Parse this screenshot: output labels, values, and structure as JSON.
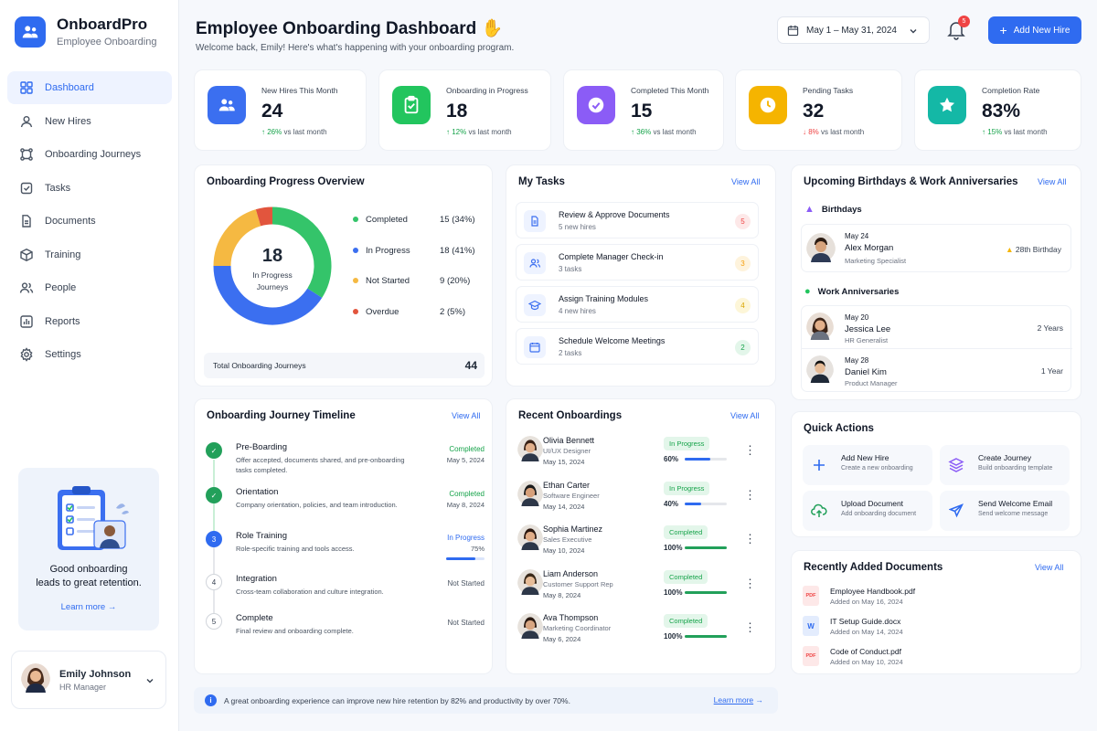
{
  "app": {
    "name": "OnboardPro",
    "subtitle": "Employee Onboarding"
  },
  "sidebar": {
    "items": [
      {
        "label": "Dashboard",
        "icon": "grid-icon",
        "active": true
      },
      {
        "label": "New Hires",
        "icon": "user-icon"
      },
      {
        "label": "Onboarding Journeys",
        "icon": "journey-icon"
      },
      {
        "label": "Tasks",
        "icon": "checkbox-icon"
      },
      {
        "label": "Documents",
        "icon": "document-icon"
      },
      {
        "label": "Training",
        "icon": "box-icon"
      },
      {
        "label": "People",
        "icon": "people-icon"
      },
      {
        "label": "Reports",
        "icon": "chart-icon"
      },
      {
        "label": "Settings",
        "icon": "gear-icon"
      }
    ],
    "promo": {
      "line1": "Good onboarding",
      "line2": "leads to great retention.",
      "link": "Learn more"
    },
    "user": {
      "name": "Emily Johnson",
      "role": "HR Manager"
    }
  },
  "header": {
    "title": "Employee Onboarding Dashboard",
    "subtitle": "Welcome back, Emily! Here's what's happening with your onboarding program.",
    "date_range": "May 1 – May 31, 2024",
    "notification_count": "5",
    "add_button": "Add New Hire"
  },
  "stats": [
    {
      "label": "New Hires This Month",
      "value": "24",
      "trend": "26%",
      "trend_text": "vs last month",
      "direction": "up",
      "color": "#3b6ff0"
    },
    {
      "label": "Onboarding in Progress",
      "value": "18",
      "trend": "12%",
      "trend_text": "vs last month",
      "direction": "up",
      "color": "#22c55e"
    },
    {
      "label": "Completed This Month",
      "value": "15",
      "trend": "36%",
      "trend_text": "vs last month",
      "direction": "up",
      "color": "#8b5cf6"
    },
    {
      "label": "Pending Tasks",
      "value": "32",
      "trend": "8%",
      "trend_text": "vs last month",
      "direction": "down",
      "color": "#f5b400"
    },
    {
      "label": "Completion Rate",
      "value": "83%",
      "trend": "15%",
      "trend_text": "vs last month",
      "direction": "up",
      "color": "#14b8a6"
    }
  ],
  "progress": {
    "title": "Onboarding Progress Overview",
    "center_value": "18",
    "center_label1": "In Progress",
    "center_label2": "Journeys",
    "legend": [
      {
        "label": "Completed",
        "value": "15",
        "pct": "(34%)",
        "color": "#34c46a",
        "count": 15
      },
      {
        "label": "In Progress",
        "value": "18",
        "pct": "(41%)",
        "color": "#3b6ff0",
        "count": 18
      },
      {
        "label": "Not Started",
        "value": "9",
        "pct": "(20%)",
        "color": "#f5b942",
        "count": 9
      },
      {
        "label": "Overdue",
        "value": "2",
        "pct": "(5%)",
        "color": "#e2553d",
        "count": 2
      }
    ],
    "total_label": "Total Onboarding Journeys",
    "total_value": "44"
  },
  "tasks": {
    "title": "My Tasks",
    "view_all": "View All",
    "items": [
      {
        "title": "Review & Approve Documents",
        "sub": "5 new hires",
        "count": "5",
        "badge_color": "#ef4444",
        "badge_bg": "#fde8e8"
      },
      {
        "title": "Complete Manager Check-in",
        "sub": "3 tasks",
        "count": "3",
        "badge_color": "#f59e0b",
        "badge_bg": "#fef3dc"
      },
      {
        "title": "Assign Training Modules",
        "sub": "4 new hires",
        "count": "4",
        "badge_color": "#d9a400",
        "badge_bg": "#fdf6d8"
      },
      {
        "title": "Schedule Welcome Meetings",
        "sub": "2 tasks",
        "count": "2",
        "badge_color": "#16a34a",
        "badge_bg": "#e3f6ea"
      }
    ]
  },
  "celebrations": {
    "title": "Upcoming Birthdays & Work Anniversaries",
    "view_all": "View All",
    "birthdays_label": "Birthdays",
    "birthdays": [
      {
        "date": "May 24",
        "name": "Alex Morgan",
        "role": "Marketing Specialist",
        "extra": "28th Birthday"
      }
    ],
    "anniversaries_label": "Work Anniversaries",
    "anniversaries": [
      {
        "date": "May 20",
        "name": "Jessica Lee",
        "role": "HR Generalist",
        "extra": "2 Years"
      },
      {
        "date": "May 28",
        "name": "Daniel Kim",
        "role": "Product Manager",
        "extra": "1 Year"
      }
    ]
  },
  "timeline": {
    "title": "Onboarding Journey Timeline",
    "view_all": "View All",
    "steps": [
      {
        "num": "",
        "title": "Pre-Boarding",
        "desc": "Offer accepted, documents shared, and pre-onboarding tasks completed.",
        "status": "Completed",
        "date": "May 5, 2024",
        "state": "done"
      },
      {
        "num": "",
        "title": "Orientation",
        "desc": "Company orientation, policies, and team introduction.",
        "status": "Completed",
        "date": "May 8, 2024",
        "state": "done"
      },
      {
        "num": "3",
        "title": "Role Training",
        "desc": "Role-specific training and tools access.",
        "status": "In Progress",
        "date": "75%",
        "state": "progress",
        "progress": 0.75
      },
      {
        "num": "4",
        "title": "Integration",
        "desc": "Cross-team collaboration and culture integration.",
        "status": "Not Started",
        "date": "",
        "state": "todo"
      },
      {
        "num": "5",
        "title": "Complete",
        "desc": "Final review and onboarding complete.",
        "status": "Not Started",
        "date": "",
        "state": "todo"
      }
    ]
  },
  "recent": {
    "title": "Recent Onboardings",
    "view_all": "View All",
    "items": [
      {
        "name": "Olivia Bennett",
        "role": "UI/UX Designer",
        "date": "May 15, 2024",
        "status": "In Progress",
        "pct": "60%",
        "progress": 0.6
      },
      {
        "name": "Ethan Carter",
        "role": "Software Engineer",
        "date": "May 14, 2024",
        "status": "In Progress",
        "pct": "40%",
        "progress": 0.4
      },
      {
        "name": "Sophia Martinez",
        "role": "Sales Executive",
        "date": "May 10, 2024",
        "status": "Completed",
        "pct": "100%",
        "progress": 1
      },
      {
        "name": "Liam Anderson",
        "role": "Customer Support Rep",
        "date": "May 8, 2024",
        "status": "Completed",
        "pct": "100%",
        "progress": 1
      },
      {
        "name": "Ava Thompson",
        "role": "Marketing Coordinator",
        "date": "May 6, 2024",
        "status": "Completed",
        "pct": "100%",
        "progress": 1
      }
    ]
  },
  "quick_actions": {
    "title": "Quick Actions",
    "items": [
      {
        "title": "Add New Hire",
        "sub": "Create a new onboarding",
        "icon": "plus-icon"
      },
      {
        "title": "Create Journey",
        "sub": "Build onboarding template",
        "icon": "layers-icon"
      },
      {
        "title": "Upload Document",
        "sub": "Add onboarding document",
        "icon": "upload-icon"
      },
      {
        "title": "Send Welcome Email",
        "sub": "Send welcome message",
        "icon": "send-icon"
      }
    ]
  },
  "documents": {
    "title": "Recently Added Documents",
    "view_all": "View All",
    "items": [
      {
        "name": "Employee Handbook.pdf",
        "date": "Added on May 16, 2024",
        "type": "PDF"
      },
      {
        "name": "IT Setup Guide.docx",
        "date": "Added on May 14, 2024",
        "type": "W"
      },
      {
        "name": "Code of Conduct.pdf",
        "date": "Added on May 10, 2024",
        "type": "PDF"
      }
    ]
  },
  "info": {
    "text": "A great onboarding experience can improve new hire retention by 82% and productivity by over 70%.",
    "link": "Learn more"
  }
}
